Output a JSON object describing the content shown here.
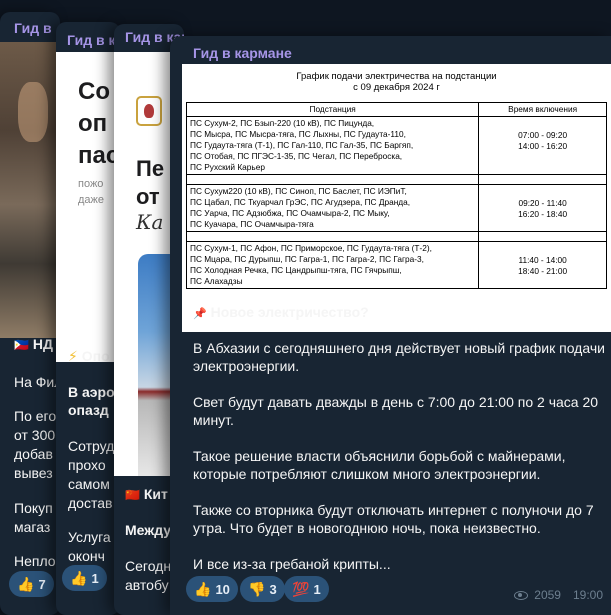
{
  "colors": {
    "background": "#0e1621",
    "bubble": "#182533",
    "channel": "#a695e7",
    "reaction": "#2b5278"
  },
  "card1": {
    "channel": "Гид в",
    "headline": "НД",
    "lines": [
      "На Фил",
      "По его",
      "от 300",
      "добав",
      "вывез",
      "Покуп",
      "магаз",
      "Непло"
    ],
    "reaction": {
      "emoji": "👍",
      "count": "7"
    }
  },
  "card2": {
    "channel": "Гид в к",
    "ad_big": [
      "Со",
      "оп",
      "пас"
    ],
    "ad_small": [
      "пожо",
      "даже"
    ],
    "headline": "Опо",
    "lines": [
      "В аэро",
      "опазд",
      "Сотруд",
      "прохо",
      "самом",
      "достав",
      "Услуга",
      "оконч"
    ],
    "reaction": {
      "emoji": "👍",
      "count": "1"
    }
  },
  "card3": {
    "channel": "Гид в кармане",
    "ad_big": [
      "Пе",
      "от"
    ],
    "ad_italic": "Ка",
    "headline": "Кит",
    "lines": [
      "Между",
      "Сегодн",
      "автобу"
    ]
  },
  "post": {
    "channel": "Гид в кармане",
    "doc": {
      "title_line1": "График подачи электричества на подстанции",
      "title_line2": "с 09 декабря 2024 г",
      "col_substation": "Подстанция",
      "col_time": "Время включения",
      "groups": [
        {
          "lines": [
            "ПС Сухум-2, ПС Бзып-220 (10 кВ), ПС Пицунда,",
            "ПС Мысра, ПС Мысра-тяга, ПС Лыхны, ПС Гудаута-110,",
            "ПС Гудаута-тяга (Т-1), ПС Гал-110, ПС Гал-35, ПС Баргяп,",
            "ПС Отобая, ПС ПГЭС-1-35, ПС Чегал, ПС Переброска,",
            "ПС Рухский Карьер"
          ],
          "times": [
            "07:00 - 09:20",
            "14:00 - 16:20"
          ]
        },
        {
          "lines": [
            "ПС Сухум220 (10 кВ), ПС Синоп, ПС Баслет, ПС ИЭПиТ,",
            "ПС Цабал, ПС Ткуарчал ГрЭС, ПС Агудзера, ПС Дранда,",
            "ПС Уарча, ПС Адзюбжа, ПС Очамчыра-2, ПС Мыку,",
            "ПС Куачара, ПС Очамчыра-тяга"
          ],
          "times": [
            "09:20 - 11:40",
            "16:20 - 18:40"
          ]
        },
        {
          "lines": [
            "ПС Сухум-1, ПС Афон, ПС Приморское, ПС Гудаута-тяга (Т-2),",
            "ПС Мцара, ПС Дурыпш, ПС Гагра-1, ПС Гагра-2, ПС Гагра-3,",
            "ПС Холодная Речка, ПС Цандрыпш-тяга, ПС Гячрыпш,",
            "ПС Алахадзы"
          ],
          "times": [
            "11:40 - 14:00",
            "18:40 - 21:00"
          ]
        }
      ]
    },
    "pin_icon": "📌",
    "headline": "Новое электричество?",
    "paragraphs": [
      [
        "В Абхазии с сегодняшнего дня действует новый график подачи",
        "электроэнергии."
      ],
      [
        "Свет будут давать дважды в день с 7:00 до 21:00 по 2 часа 20",
        "минут."
      ],
      [
        "Такое решение власти объяснили борьбой с майнерами,",
        "которые потребляют слишком много электроэнергии."
      ],
      [
        "Также со вторника будут отключать интернет с полуночи до 7",
        "утра. Что будет в новогоднюю ночь, пока неизвестно."
      ],
      [
        "И все из-за гребаной крипты..."
      ]
    ],
    "reactions": [
      {
        "emoji": "👍",
        "count": "10"
      },
      {
        "emoji": "👎",
        "count": "3"
      },
      {
        "emoji": "💯",
        "count": "1"
      }
    ],
    "views": "2059",
    "time": "19:00"
  }
}
